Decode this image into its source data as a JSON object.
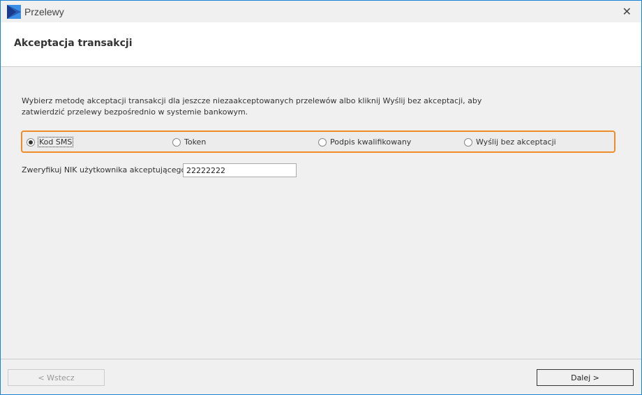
{
  "window": {
    "title": "Przelewy",
    "close_icon": "close-icon"
  },
  "header": {
    "title": "Akceptacja transakcji"
  },
  "description": "Wybierz metodę akceptacji transakcji dla jeszcze niezaakceptowanych przelewów albo kliknij Wyślij bez akceptacji, aby zatwierdzić przelewy bezpośrednio w systemie bankowym.",
  "methods": [
    {
      "label": "Kod SMS",
      "selected": true
    },
    {
      "label": "Token",
      "selected": false
    },
    {
      "label": "Podpis kwalifikowany",
      "selected": false
    },
    {
      "label": "Wyślij bez akceptacji",
      "selected": false
    }
  ],
  "nik": {
    "label": "Zweryfikuj NIK użytkownika akceptującego:",
    "value": "22222222"
  },
  "buttons": {
    "back": "< Wstecz",
    "next": "Dalej >"
  },
  "colors": {
    "accent": "#f08c28",
    "border": "#1883d7"
  }
}
